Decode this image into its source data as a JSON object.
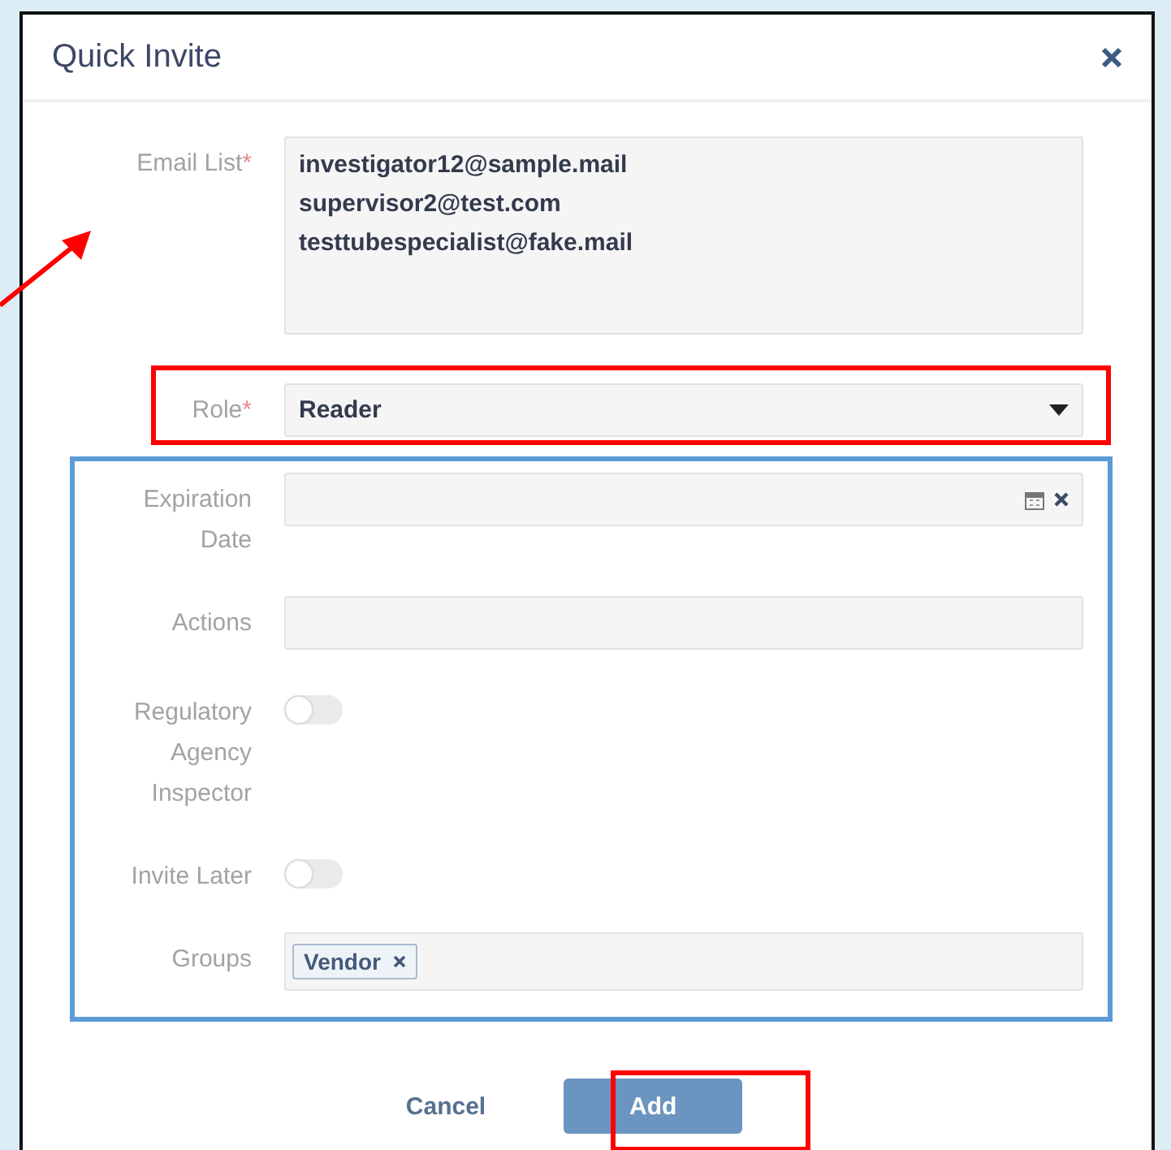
{
  "dialog": {
    "title": "Quick Invite"
  },
  "fields": [
    {
      "kind": "textarea",
      "label": "Email List",
      "required_mark": "*",
      "value": "investigator12@sample.mail\nsupervisor2@test.com\ntesttubespecialist@fake.mail"
    },
    {
      "kind": "select",
      "label": "Role",
      "required_mark": "*",
      "value": "Reader"
    },
    {
      "kind": "date",
      "label": "Expiration Date"
    },
    {
      "kind": "text",
      "label": "Actions"
    },
    {
      "kind": "toggle",
      "label": "Regulatory Agency Inspector",
      "on": false
    },
    {
      "kind": "toggle",
      "label": "Invite Later",
      "on": false
    },
    {
      "kind": "tags",
      "label": "Groups",
      "tags": [
        "Vendor"
      ]
    }
  ],
  "buttons": [
    {
      "kind": "link",
      "label": "Cancel"
    },
    {
      "kind": "primary",
      "label": "Add"
    }
  ]
}
